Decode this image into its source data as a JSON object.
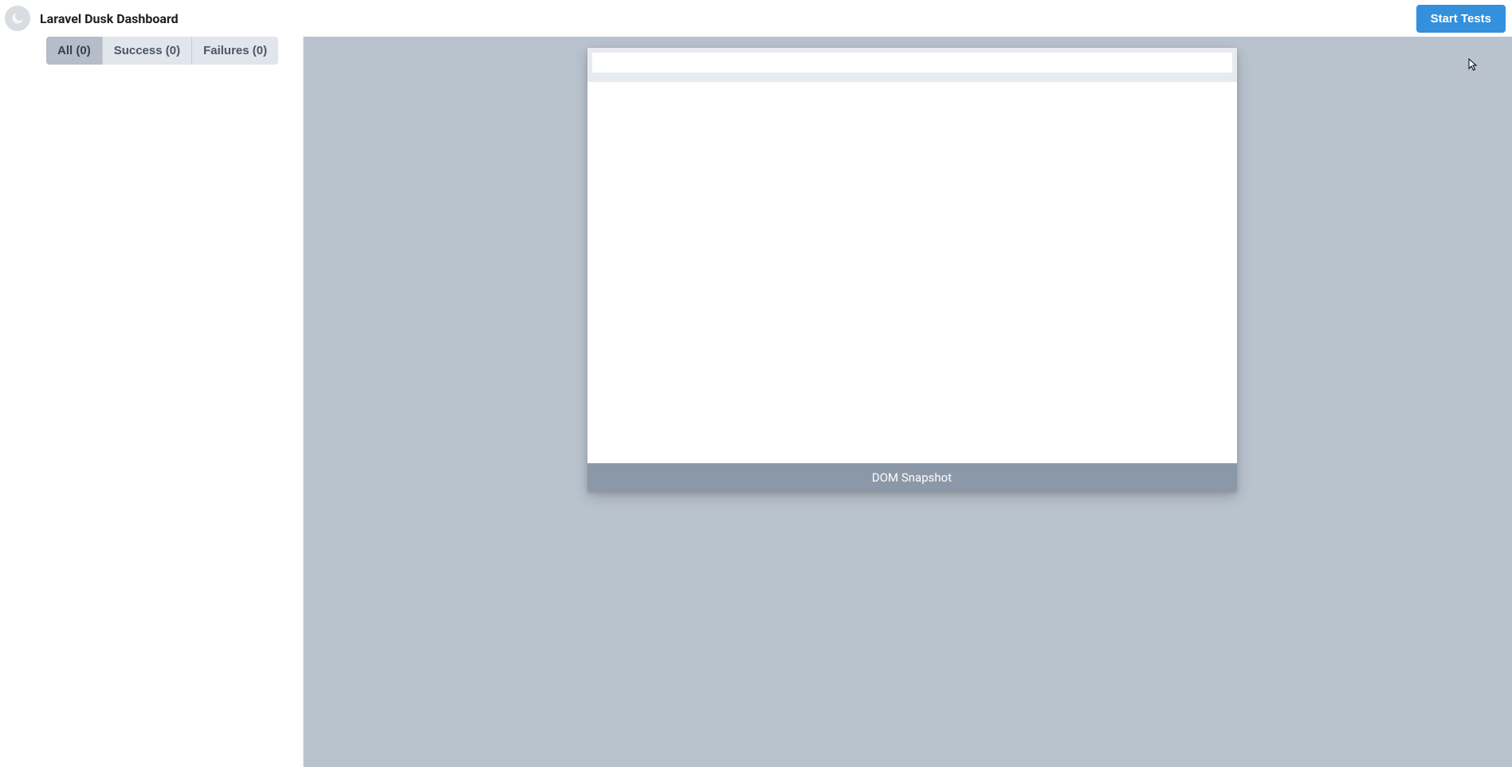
{
  "header": {
    "title": "Laravel Dusk Dashboard",
    "start_button": "Start Tests"
  },
  "tabs": {
    "all": {
      "label": "All",
      "count": 0
    },
    "success": {
      "label": "Success",
      "count": 0
    },
    "failures": {
      "label": "Failures",
      "count": 0
    }
  },
  "preview": {
    "footer_label": "DOM Snapshot"
  }
}
